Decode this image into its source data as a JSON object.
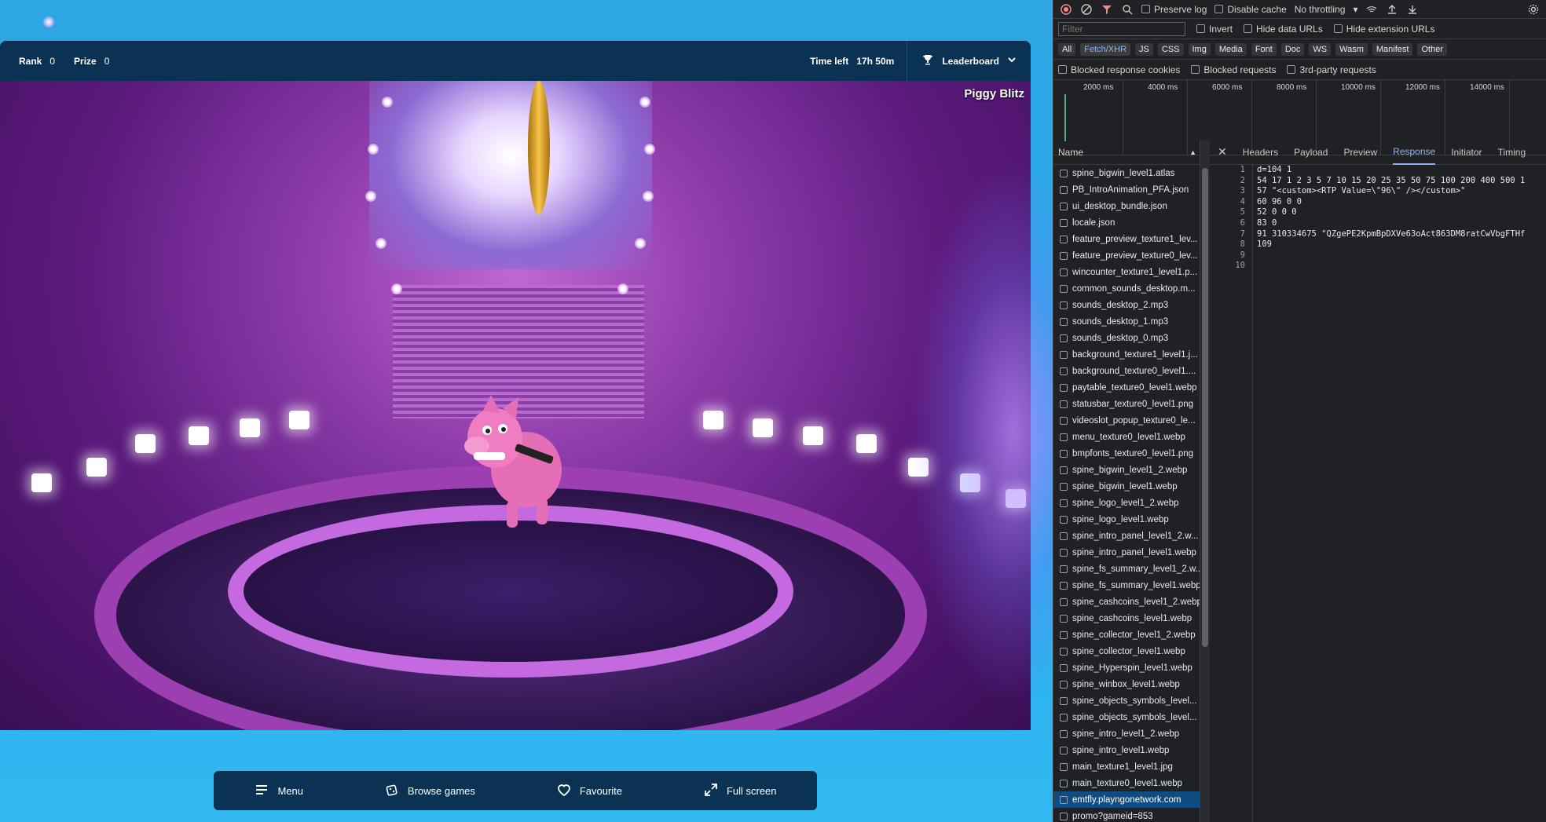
{
  "game": {
    "rank_label": "Rank",
    "rank_value": "0",
    "prize_label": "Prize",
    "prize_value": "0",
    "time_left_label": "Time left",
    "time_left_value": "17h 50m",
    "leaderboard_label": "Leaderboard",
    "title": "Piggy Blitz"
  },
  "bottom_bar": {
    "menu": "Menu",
    "browse": "Browse games",
    "favourite": "Favourite",
    "fullscreen": "Full screen"
  },
  "devtools": {
    "toolbar": {
      "preserve_log": "Preserve log",
      "disable_cache": "Disable cache",
      "throttling": "No throttling"
    },
    "filter": {
      "placeholder": "Filter",
      "invert": "Invert",
      "hide_data_urls": "Hide data URLs",
      "hide_extension_urls": "Hide extension URLs"
    },
    "types": [
      "All",
      "Fetch/XHR",
      "JS",
      "CSS",
      "Img",
      "Media",
      "Font",
      "Doc",
      "WS",
      "Wasm",
      "Manifest",
      "Other"
    ],
    "active_type": "Fetch/XHR",
    "blocked": {
      "response_cookies": "Blocked response cookies",
      "requests": "Blocked requests",
      "third_party": "3rd-party requests"
    },
    "timeline_ticks": [
      "2000 ms",
      "4000 ms",
      "6000 ms",
      "8000 ms",
      "10000 ms",
      "12000 ms",
      "14000 ms"
    ],
    "name_header": "Name",
    "requests": [
      "spine_bigwin_level1.atlas",
      "PB_IntroAnimation_PFA.json",
      "ui_desktop_bundle.json",
      "locale.json",
      "feature_preview_texture1_lev...",
      "feature_preview_texture0_lev...",
      "wincounter_texture1_level1.p...",
      "common_sounds_desktop.m...",
      "sounds_desktop_2.mp3",
      "sounds_desktop_1.mp3",
      "sounds_desktop_0.mp3",
      "background_texture1_level1.j...",
      "background_texture0_level1....",
      "paytable_texture0_level1.webp",
      "statusbar_texture0_level1.png",
      "videoslot_popup_texture0_le...",
      "menu_texture0_level1.webp",
      "bmpfonts_texture0_level1.png",
      "spine_bigwin_level1_2.webp",
      "spine_bigwin_level1.webp",
      "spine_logo_level1_2.webp",
      "spine_logo_level1.webp",
      "spine_intro_panel_level1_2.w...",
      "spine_intro_panel_level1.webp",
      "spine_fs_summary_level1_2.w...",
      "spine_fs_summary_level1.webp",
      "spine_cashcoins_level1_2.webp",
      "spine_cashcoins_level1.webp",
      "spine_collector_level1_2.webp",
      "spine_collector_level1.webp",
      "spine_Hyperspin_level1.webp",
      "spine_winbox_level1.webp",
      "spine_objects_symbols_level...",
      "spine_objects_symbols_level...",
      "spine_intro_level1_2.webp",
      "spine_intro_level1.webp",
      "main_texture1_level1.jpg",
      "main_texture0_level1.webp",
      "emtfly.playngonetwork.com",
      "promo?gameid=853"
    ],
    "selected_request": "emtfly.playngonetwork.com",
    "tabs": [
      "Headers",
      "Payload",
      "Preview",
      "Response",
      "Initiator",
      "Timing"
    ],
    "active_tab": "Response",
    "response_lines": [
      "d=104 1",
      "54 17 1 2 3 5 7 10 15 20 25 35 50 75 100 200 400 500 1",
      "57 \"<custom><RTP Value=\\\"96\\\" /></custom>\"",
      "60 96 0 0",
      "52 0 0 0",
      "83 0",
      "91 310334675 \"QZgePE2KpmBpDXVe63oAct863DM8ratCwVbgFTHf",
      "109",
      "",
      ""
    ]
  },
  "colors": {
    "page_bg": "#2aa9e6",
    "bar_bg": "#0b3253",
    "devtools_bg": "#202124",
    "devtools_accent": "#8ab4f8",
    "stage_purple": "#8b3aa8"
  }
}
